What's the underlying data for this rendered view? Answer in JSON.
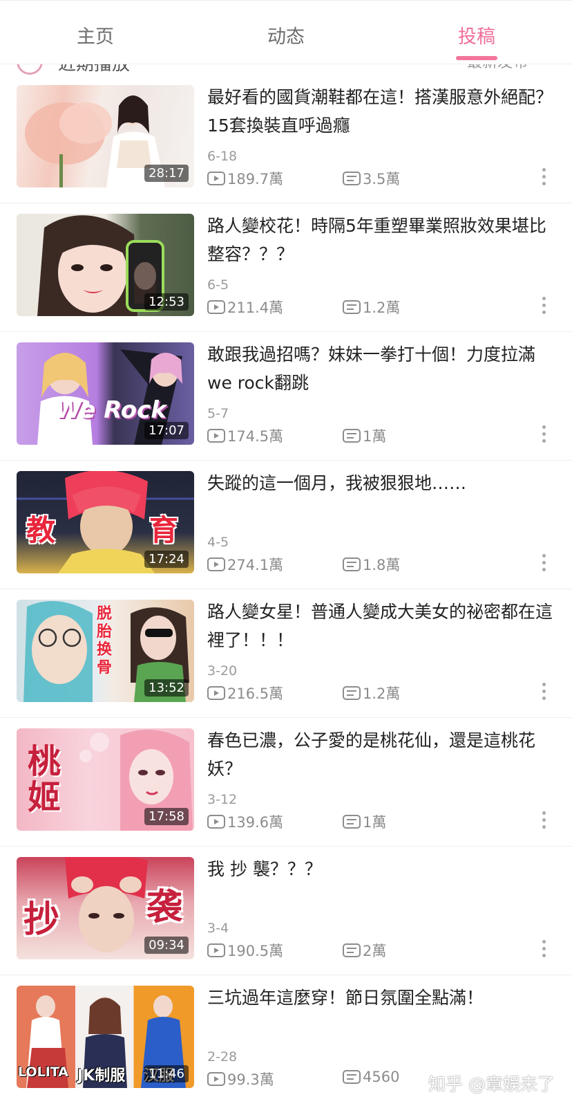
{
  "tabs": [
    "主页",
    "动态",
    "投稿"
  ],
  "active_tab": "投稿",
  "accent_color": "#f3759c",
  "sort_bar": {
    "left_label": "近期播放",
    "right_label": "最新发布"
  },
  "videos": [
    {
      "title": "最好看的國貨潮鞋都在這！搭漢服意外絕配？15套換裝直呼過癮",
      "duration": "28:17",
      "date": "6-18",
      "views": "189.7萬",
      "comments": "3.5萬"
    },
    {
      "title": "路人變校花！時隔5年重塑畢業照妝效果堪比整容？？？",
      "duration": "12:53",
      "date": "6-5",
      "views": "211.4萬",
      "comments": "1.2萬"
    },
    {
      "title": "敢跟我過招嗎？妹妹一拳打十個！力度拉滿we  rock翻跳",
      "duration": "17:07",
      "date": "5-7",
      "views": "174.5萬",
      "comments": "1萬",
      "thumb_text": "We Rock"
    },
    {
      "title": "失蹤的這一個月，我被狠狠地……",
      "duration": "17:24",
      "date": "4-5",
      "views": "274.1萬",
      "comments": "1.8萬",
      "thumb_text_left": "教",
      "thumb_text_right": "育"
    },
    {
      "title": "路人變女星！普通人變成大美女的祕密都在這裡了！！！",
      "duration": "13:52",
      "date": "3-20",
      "views": "216.5萬",
      "comments": "1.2萬",
      "thumb_text": "脱胎换骨"
    },
    {
      "title": "春色已濃，公子愛的是桃花仙，還是這桃花妖？",
      "duration": "17:58",
      "date": "3-12",
      "views": "139.6萬",
      "comments": "1萬",
      "thumb_text": "桃姬"
    },
    {
      "title": "我 抄 襲？？？",
      "duration": "09:34",
      "date": "3-4",
      "views": "190.5萬",
      "comments": "2萬",
      "thumb_text_left": "抄",
      "thumb_text_right": "袭"
    },
    {
      "title": "三坑過年這麼穿！節日氛圍全點滿！",
      "duration": "11:46",
      "date": "2-28",
      "views": "99.3萬",
      "comments": "4560",
      "thumb_labels": [
        "LOLITA",
        "JK制服",
        "汉服"
      ]
    }
  ],
  "watermark": "知乎 @章娱来了"
}
